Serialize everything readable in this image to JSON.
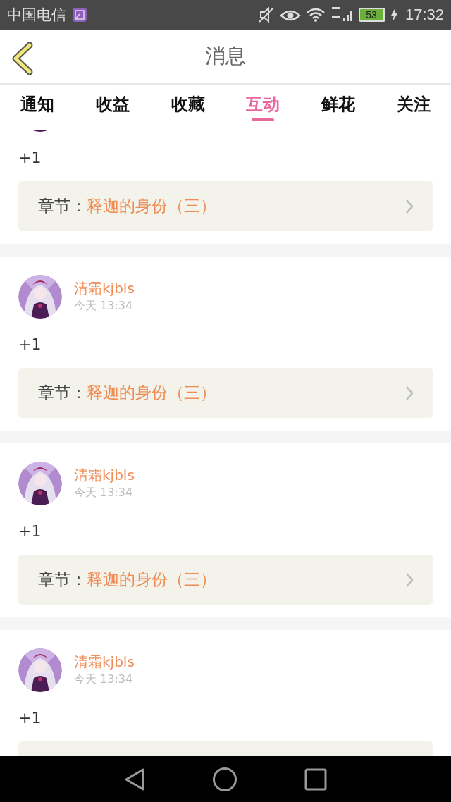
{
  "status_bar": {
    "carrier": "中国电信",
    "battery": "53",
    "time": "17:32"
  },
  "header": {
    "title": "消息"
  },
  "tabs": [
    {
      "label": "通知",
      "selected": false
    },
    {
      "label": "收益",
      "selected": false
    },
    {
      "label": "收藏",
      "selected": false
    },
    {
      "label": "互动",
      "selected": true
    },
    {
      "label": "鲜花",
      "selected": false
    },
    {
      "label": "关注",
      "selected": false
    }
  ],
  "messages": [
    {
      "text": "+1",
      "chapter_label": "章节：",
      "chapter": "释迦的身份（三）"
    },
    {
      "user": "清霜kjbls",
      "time": "今天 13:34",
      "text": "+1",
      "chapter_label": "章节：",
      "chapter": "释迦的身份（三）"
    },
    {
      "user": "清霜kjbls",
      "time": "今天 13:34",
      "text": "+1",
      "chapter_label": "章节：",
      "chapter": "释迦的身份（三）"
    },
    {
      "user": "清霜kjbls",
      "time": "今天 13:34",
      "text": "+1"
    }
  ]
}
